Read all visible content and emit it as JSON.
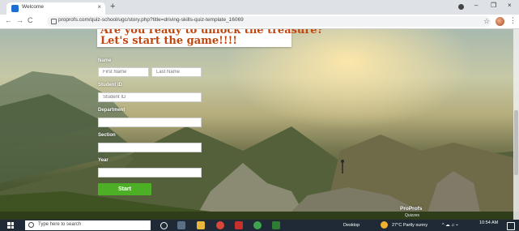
{
  "browser": {
    "tab_title": "Welcome",
    "tab_close": "×",
    "new_tab": "+",
    "url": "proprofs.com/quiz-school/ugc/story.php?title=driving-skills-quiz-template_16069",
    "window_minimize": "–",
    "window_maximize": "❐",
    "window_close": "×",
    "back": "←",
    "forward": "→",
    "reload": "C",
    "star": "☆",
    "menu": "⋮"
  },
  "quiz": {
    "heading_line1": "Are you ready to unlock the treasure?",
    "heading_line2": "Let's start the game!!!!",
    "name_label": "Name",
    "first_name_placeholder": "First Name",
    "last_name_placeholder": "Last Name",
    "student_id_label": "Student ID",
    "student_id_placeholder": "Student ID",
    "department_label": "Department",
    "section_label": "Section",
    "year_label": "Year",
    "start_button": "Start",
    "badge": "ProProfs",
    "badge_sub": "Quizzes"
  },
  "taskbar": {
    "search_placeholder": "Type here to search",
    "desktop_label": "Desktop",
    "weather": "27°C  Partly sunny",
    "time": "10:54 AM"
  },
  "colors": {
    "heading": "#c0460f",
    "start_button": "#4caf26",
    "taskbar": "#1f2a36"
  }
}
